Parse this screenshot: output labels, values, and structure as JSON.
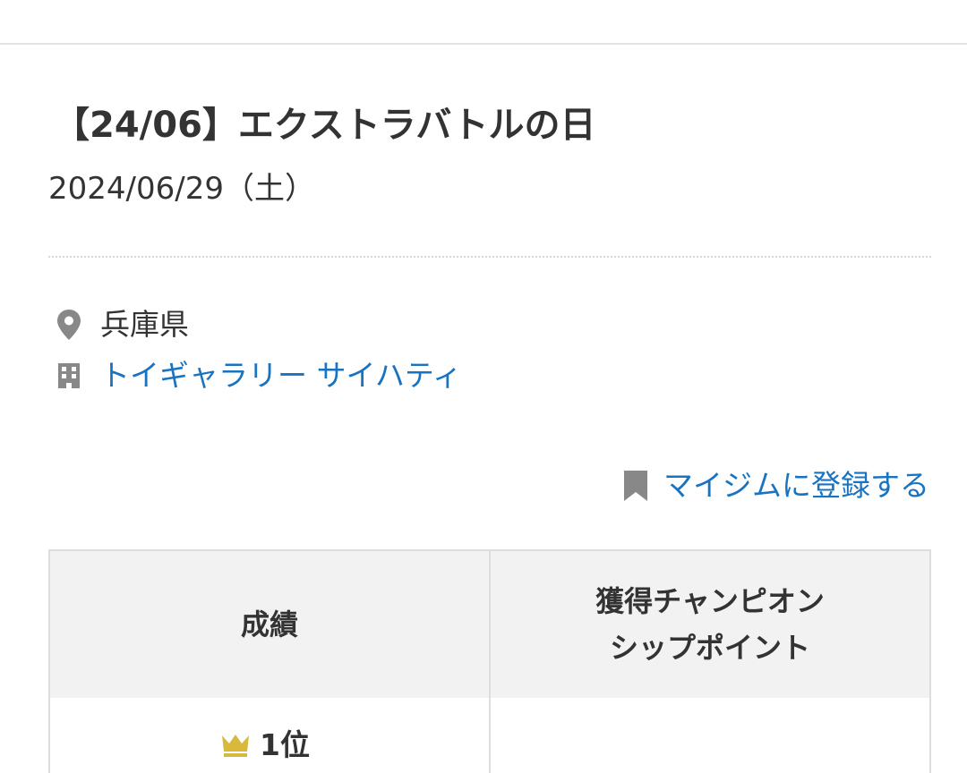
{
  "event": {
    "title": "【24/06】エクストラバトルの日",
    "date": "2024/06/29（土）"
  },
  "location": {
    "prefecture": "兵庫県",
    "venue": "トイギャラリー サイハティ",
    "location_icon": "map-pin-icon",
    "venue_icon": "building-icon"
  },
  "mygym": {
    "label": "マイジムに登録する",
    "icon": "bookmark-icon"
  },
  "results_table": {
    "headers": [
      "成績",
      "獲得チャンピオン\nシップポイント"
    ],
    "rows": [
      {
        "rank": "1位",
        "rank_icon": "crown-icon",
        "points": ""
      }
    ]
  },
  "colors": {
    "link": "#1a73c0",
    "text": "#333333",
    "icon_gray": "#888888",
    "crown_gold": "#d9b93c",
    "table_header_bg": "#f2f2f2"
  }
}
